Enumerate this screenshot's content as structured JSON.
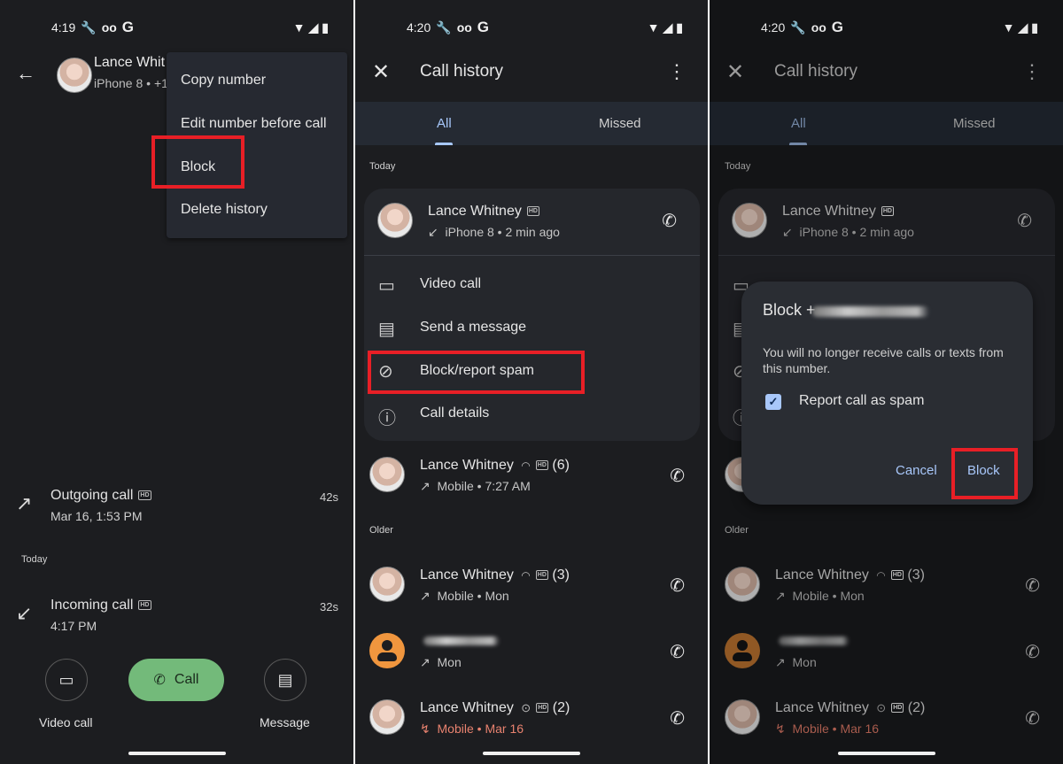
{
  "colors": {
    "accent": "#a8c7fa",
    "call_button": "#73ba7a",
    "highlight_box": "#e81f26",
    "missed": "#e8826f",
    "unknown_avatar": "#f0963e"
  },
  "panel1": {
    "status": {
      "time": "4:19"
    },
    "contact": {
      "name": "Lance Whit",
      "subtitle": "iPhone 8 • +1"
    },
    "overflow_menu": {
      "items": [
        "Copy number",
        "Edit number before call",
        "Block",
        "Delete history"
      ],
      "highlighted": "Block"
    },
    "history": [
      {
        "direction": "outgoing",
        "title": "Outgoing call",
        "hd": "HD",
        "time": "Mar 16, 1:53 PM",
        "duration": "42s"
      },
      {
        "section": "Today"
      },
      {
        "direction": "incoming",
        "title": "Incoming call",
        "hd": "HD",
        "time": "4:17 PM",
        "duration": "32s"
      }
    ],
    "actions": {
      "video_call": "Video call",
      "call": "Call",
      "message": "Message"
    }
  },
  "panel2": {
    "status": {
      "time": "4:20"
    },
    "title": "Call history",
    "tabs": [
      "All",
      "Missed"
    ],
    "active_tab": "All",
    "sections": {
      "today": "Today",
      "older": "Older"
    },
    "expanded_entry": {
      "name": "Lance Whitney",
      "hd": "HD",
      "subtitle": "iPhone 8 • 2 min ago",
      "direction": "incoming",
      "actions": [
        "Video call",
        "Send a message",
        "Block/report spam",
        "Call details"
      ],
      "highlighted_action": "Block/report spam"
    },
    "entries": [
      {
        "name": "Lance Whitney",
        "badges": [
          "wifi",
          "HD"
        ],
        "count": "(6)",
        "subtitle": "Mobile • 7:27 AM",
        "direction": "outgoing",
        "missed": false
      },
      {
        "name": "Lance Whitney",
        "badges": [
          "wifi",
          "HD"
        ],
        "count": "(3)",
        "subtitle": "Mobile • Mon",
        "direction": "outgoing",
        "missed": false
      },
      {
        "name": "",
        "redacted": true,
        "badges": [],
        "count": "",
        "subtitle": "Mon",
        "direction": "outgoing",
        "missed": false
      },
      {
        "name": "Lance Whitney",
        "badges": [
          "verified",
          "HD"
        ],
        "count": "(2)",
        "subtitle": "Mobile • Mar 16",
        "direction": "missed",
        "missed": true
      }
    ]
  },
  "panel3": {
    "status": {
      "time": "4:20"
    },
    "dialog": {
      "title": "Block +",
      "body": "You will no longer receive calls or texts from this number.",
      "checkbox_label": "Report call as spam",
      "checkbox_checked": true,
      "cancel": "Cancel",
      "confirm": "Block"
    }
  },
  "icons": {
    "back": "←",
    "close": "✕",
    "kebab": "⋮",
    "phone": "✆",
    "outgoing": "↗",
    "incoming": "↙",
    "missed": "↯",
    "video": "▭",
    "message": "▤",
    "block": "⊘",
    "info": "ⓘ",
    "wifi": "◠",
    "verified": "⊙",
    "check": "✓",
    "wrench": "🔧",
    "voicemail": "oo",
    "google": "G",
    "signal": "◢",
    "battery": "▮",
    "wifi_status": "▼"
  }
}
